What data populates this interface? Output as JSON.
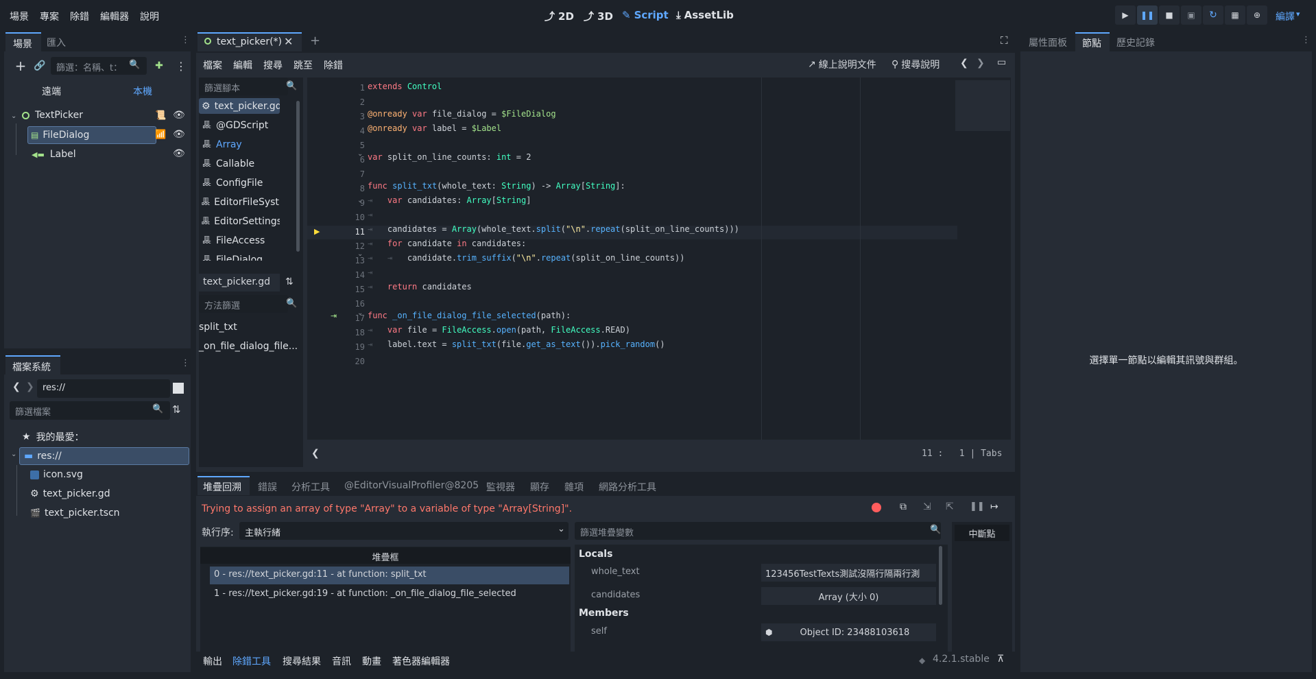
{
  "menu": {
    "scene": "場景",
    "project": "專案",
    "debug": "除錯",
    "editor": "編輯器",
    "help": "說明"
  },
  "modes": {
    "m2d": "2D",
    "m3d": "3D",
    "script": "Script",
    "assetlib": "AssetLib"
  },
  "renderer": "編譯",
  "scene_dock": {
    "tab_scene": "場景",
    "tab_import": "匯入",
    "filter_placeholder": "篩選：名稱、t：",
    "remote": "遠端",
    "local": "本機",
    "nodes": [
      {
        "name": "TextPicker",
        "icon": "control-node-icon"
      },
      {
        "name": "FileDialog",
        "icon": "file-dialog-node-icon"
      },
      {
        "name": "Label",
        "icon": "label-node-icon"
      }
    ]
  },
  "filesystem": {
    "tab": "檔案系統",
    "path": "res://",
    "filter_placeholder": "篩選檔案",
    "favorites": "我的最愛：",
    "root": "res://",
    "files": [
      "icon.svg",
      "text_picker.gd",
      "text_picker.tscn"
    ]
  },
  "script_editor": {
    "tab": "text_picker(*)",
    "menu": {
      "file": "檔案",
      "edit": "編輯",
      "search": "搜尋",
      "goto": "跳至",
      "debug": "除錯"
    },
    "online_docs": "線上說明文件",
    "search_help": "搜尋說明",
    "filter_scripts": "篩選腳本",
    "scripts": [
      "text_picker.gd",
      "@GDScript",
      "Array",
      "Callable",
      "ConfigFile",
      "EditorFileSyst...",
      "EditorSettings",
      "FileAccess",
      "FileDialog"
    ],
    "current_script": "text_picker.gd",
    "filter_methods": "方法篩選",
    "methods": [
      "split_txt",
      "_on_file_dialog_file..."
    ],
    "cursor": {
      "line": "11",
      "col": "1",
      "indent": "Tabs"
    },
    "line_numbers": [
      "1",
      "2",
      "3",
      "4",
      "5",
      "6",
      "7",
      "8",
      "9",
      "10",
      "11",
      "12",
      "13",
      "14",
      "15",
      "16",
      "17",
      "18",
      "19",
      "20"
    ]
  },
  "debugger": {
    "tabs": [
      "堆疊回溯",
      "錯誤",
      "分析工具",
      "@EditorVisualProfiler@8205",
      "監視器",
      "顯存",
      "雜項",
      "網路分析工具"
    ],
    "error": "Trying to assign an array of type \"Array\" to a variable of type \"Array[String]\".",
    "thread_label": "執行序:",
    "thread_value": "主執行緒",
    "stack_header": "堆疊框",
    "frames": [
      "0 - res://text_picker.gd:11 - at function: split_txt",
      "1 - res://text_picker.gd:19 - at function: _on_file_dialog_file_selected"
    ],
    "filter_vars": "篩選堆疊變數",
    "locals_header": "Locals",
    "locals": [
      {
        "name": "whole_text",
        "value": "123456TestTexts測試沒隔行隔兩行測"
      },
      {
        "name": "candidates",
        "value": "Array (大小 0)"
      }
    ],
    "members_header": "Members",
    "members": [
      {
        "name": "self",
        "value": "Object ID: 23488103618"
      }
    ],
    "breakpoints": "中斷點"
  },
  "bottom_bar": {
    "items": [
      "輸出",
      "除錯工具",
      "搜尋結果",
      "音訊",
      "動畫",
      "著色器編輯器"
    ],
    "version": "4.2.1.stable"
  },
  "right_dock": {
    "tabs": [
      "屬性面板",
      "節點",
      "歷史記錄"
    ],
    "message": "選擇單一節點以編輯其訊號與群組。"
  },
  "colors": {
    "accent": "#5fa8ff",
    "error": "#ff786b",
    "background": "#1d2229",
    "panel": "#262c35"
  }
}
